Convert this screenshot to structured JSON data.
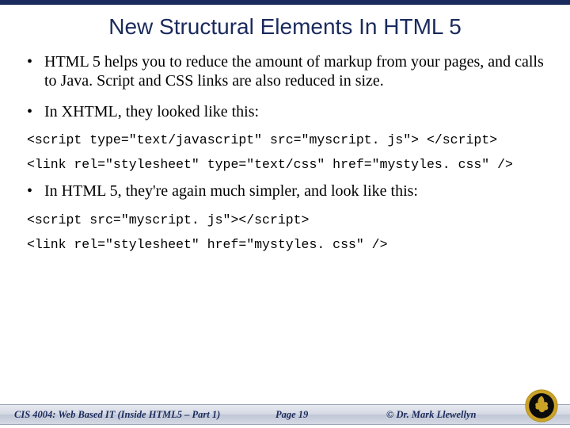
{
  "title": "New Structural Elements In HTML 5",
  "bullets": {
    "b1": "HTML 5 helps you to reduce the amount of markup from your pages, and calls to Java. Script and CSS links are also reduced in size.",
    "b2": "In XHTML, they looked like this:",
    "b3": "In HTML 5, they're again much simpler, and look like this:"
  },
  "code": {
    "c1": "<script type=\"text/javascript\" src=\"myscript. js\"> </script>",
    "c2": "<link rel=\"stylesheet\" type=\"text/css\" href=\"mystyles. css\" />",
    "c3": "<script src=\"myscript. js\"></script>",
    "c4": "<link rel=\"stylesheet\" href=\"mystyles. css\" />"
  },
  "footer": {
    "course": "CIS 4004: Web Based IT (Inside HTML5 – Part 1)",
    "page": "Page 19",
    "author": "© Dr. Mark Llewellyn"
  }
}
